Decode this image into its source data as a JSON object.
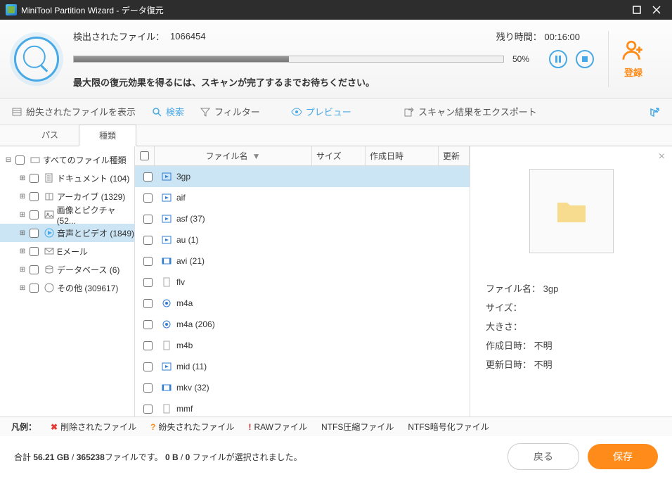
{
  "titlebar": {
    "title": "MiniTool Partition Wizard - データ復元"
  },
  "scan": {
    "found_label": "検出されたファイル：",
    "found_count": "1066454",
    "time_label": "残り時間：",
    "time_value": "00:16:00",
    "percent": "50%",
    "note": "最大限の復元効果を得るには、スキャンが完了するまでお待ちください。"
  },
  "register": {
    "label": "登録"
  },
  "toolbar": {
    "lost": "紛失されたファイルを表示",
    "search": "検索",
    "filter": "フィルター",
    "preview": "プレビュー",
    "export": "スキャン結果をエクスポート"
  },
  "tabs": {
    "path": "パス",
    "type": "種類"
  },
  "tree": {
    "root": "すべてのファイル種類",
    "items": [
      {
        "label": "ドキュメント (104)",
        "icon": "doc"
      },
      {
        "label": "アーカイブ (1329)",
        "icon": "arc"
      },
      {
        "label": "画像とピクチャ (52...",
        "icon": "img"
      },
      {
        "label": "音声とビデオ (1849)",
        "icon": "av",
        "selected": true
      },
      {
        "label": "Eメール",
        "icon": "mail"
      },
      {
        "label": "データベース (6)",
        "icon": "db"
      },
      {
        "label": "その他 (309617)",
        "icon": "other"
      }
    ]
  },
  "columns": {
    "name": "ファイル名",
    "size": "サイズ",
    "date": "作成日時",
    "upd": "更新"
  },
  "files": [
    {
      "name": "3gp",
      "selected": true,
      "icon": "media"
    },
    {
      "name": "aif",
      "icon": "media"
    },
    {
      "name": "asf (37)",
      "icon": "media"
    },
    {
      "name": "au (1)",
      "icon": "media"
    },
    {
      "name": "avi (21)",
      "icon": "video"
    },
    {
      "name": "flv",
      "icon": "plain"
    },
    {
      "name": "m4a",
      "icon": "audio"
    },
    {
      "name": "m4a (206)",
      "icon": "audio"
    },
    {
      "name": "m4b",
      "icon": "plain"
    },
    {
      "name": "mid (11)",
      "icon": "media"
    },
    {
      "name": "mkv (32)",
      "icon": "video"
    },
    {
      "name": "mmf",
      "icon": "plain"
    }
  ],
  "preview": {
    "name_label": "ファイル名：",
    "name_value": "3gp",
    "size_label": "サイズ：",
    "dim_label": "大きさ：",
    "created_label": "作成日時：",
    "created_value": "不明",
    "updated_label": "更新日時：",
    "updated_value": "不明"
  },
  "legend": {
    "title": "凡例：",
    "deleted": "削除されたファイル",
    "lost": "紛失されたファイル",
    "raw": "RAWファイル",
    "ntfs_comp": "NTFS圧縮ファイル",
    "ntfs_enc": "NTFS暗号化ファイル"
  },
  "footer": {
    "status_prefix": "合計 ",
    "status_size": "56.21 GB",
    "status_mid": " / ",
    "status_files": "365238",
    "status_suffix1": "ファイルです。",
    "status_sel_size": "0 B",
    "status_sel_mid": " / ",
    "status_sel_count": "0",
    "status_suffix2": " ファイルが選択されました。",
    "back": "戻る",
    "save": "保存"
  }
}
